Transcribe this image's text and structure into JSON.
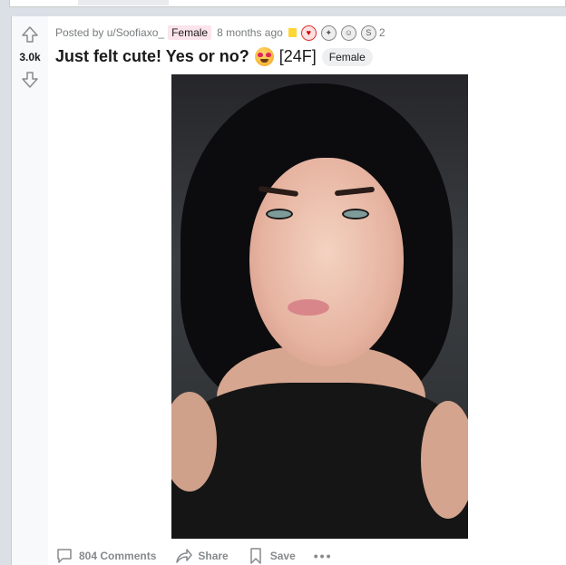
{
  "post": {
    "score": "3.0k",
    "posted_by": "Posted by u/Soofiaxo_",
    "user_flair": "Female",
    "time_ago": "8 months ago",
    "award_count": "2",
    "title": "Just felt cute! Yes or no?",
    "title_tag": "[24F]",
    "post_flair": "Female"
  },
  "actions": {
    "comments": "804 Comments",
    "share": "Share",
    "save": "Save",
    "more": "•••"
  },
  "icons": {
    "upvote": "arrow-up-icon",
    "downvote": "arrow-down-icon",
    "comment": "comment-icon",
    "share": "share-icon",
    "save": "bookmark-icon"
  },
  "colors": {
    "background": "#dae0e6",
    "meta": "#787c7e",
    "user_flair_bg": "#fce4ec",
    "post_flair_bg": "#edeff1"
  }
}
